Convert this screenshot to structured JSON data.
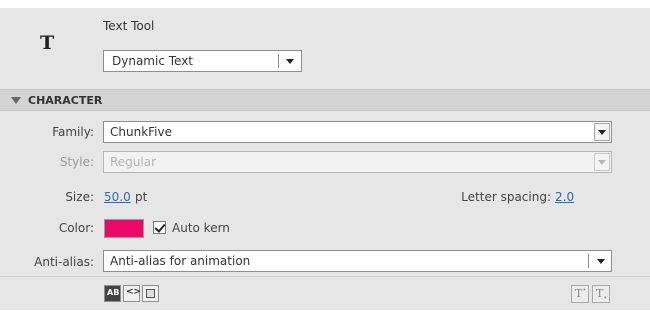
{
  "header": {
    "tool_icon_glyph": "T",
    "tool_name": "Text Tool",
    "text_type": "Dynamic Text"
  },
  "section": {
    "title": "CHARACTER"
  },
  "family": {
    "label": "Family:",
    "value": "ChunkFive"
  },
  "style": {
    "label": "Style:",
    "value": "Regular"
  },
  "size": {
    "label": "Size:",
    "value": "50.0",
    "unit": "pt"
  },
  "letter_spacing": {
    "label": "Letter spacing:",
    "value": "2.0"
  },
  "color": {
    "label": "Color:",
    "swatch": "#ec0a67"
  },
  "auto_kern": {
    "label": "Auto kern",
    "checked": true
  },
  "anti_alias": {
    "label": "Anti-alias:",
    "value": "Anti-alias for animation"
  },
  "footer": {
    "selectable_glyph": "AB",
    "html_glyph": "<>",
    "superscript_glyph": "T",
    "subscript_glyph": "T"
  }
}
